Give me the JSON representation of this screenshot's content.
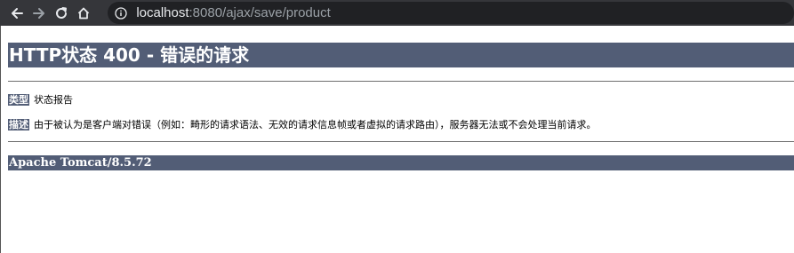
{
  "browser": {
    "url_host": "localhost",
    "url_rest": ":8080/ajax/save/product"
  },
  "error_page": {
    "title": "HTTP状态 400 - 错误的请求",
    "type_label": "类型",
    "type_value": "状态报告",
    "description_label": "描述",
    "description_value": "由于被认为是客户端对错误（例如：畸形的请求语法、无效的请求信息帧或者虚拟的请求路由），服务器无法或不会处理当前请求。",
    "footer": "Apache Tomcat/8.5.72"
  },
  "colors": {
    "toolbar_bg": "#35363a",
    "omnibox_bg": "#202124",
    "tomcat_banner": "#525d76"
  }
}
